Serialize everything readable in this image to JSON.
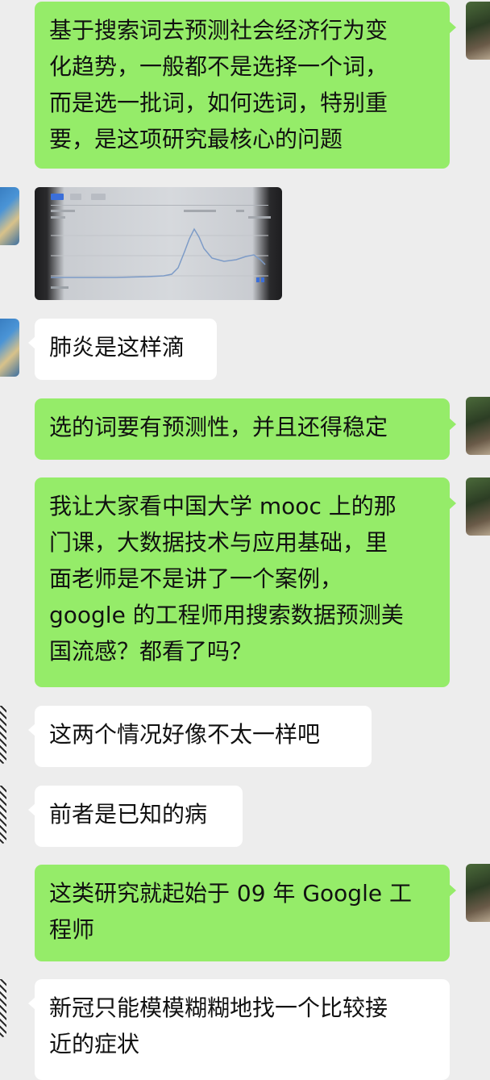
{
  "messages": [
    {
      "side": "right",
      "text": "基于搜索词去预测社会经济行为变\n化趋势，一般都不是选择一个词，\n而是选一批词，如何选词，特别重\n要，是这项研究最核心的问题"
    },
    {
      "side": "left",
      "type": "image",
      "icon": "trend-chart-photo"
    },
    {
      "side": "left",
      "text": "肺炎是这样滴"
    },
    {
      "side": "right",
      "text": "选的词要有预测性，并且还得稳定"
    },
    {
      "side": "right",
      "text": "我让大家看中国大学 mooc 上的那\n门课，大数据技术与应用基础，里\n面老师是不是讲了一个案例，\ngoogle 的工程师用搜索数据预测美\n国流感？都看了吗？"
    },
    {
      "side": "left",
      "text": "这两个情况好像不太一样吧"
    },
    {
      "side": "left",
      "text": "前者是已知的病"
    },
    {
      "side": "right",
      "text": "这类研究就起始于 09 年 Google 工\n程师"
    },
    {
      "side": "left",
      "text": "新冠只能模模糊糊地找一个比较接\n近的症状"
    }
  ],
  "colors": {
    "background": "#ededed",
    "sent_bubble": "#95ec69",
    "received_bubble": "#ffffff"
  }
}
